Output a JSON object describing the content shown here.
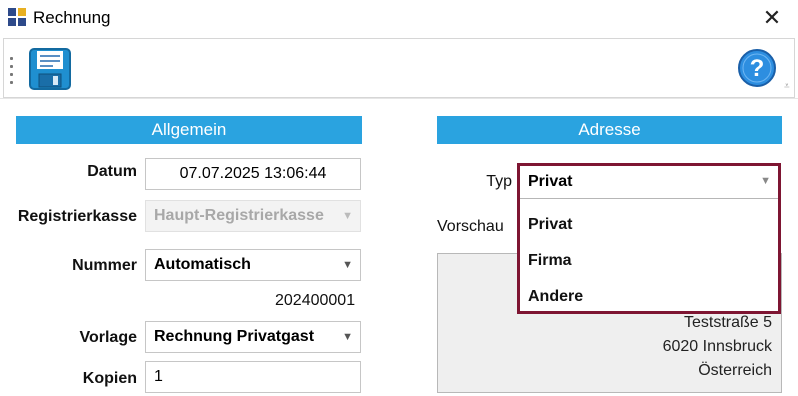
{
  "window": {
    "title": "Rechnung",
    "close_glyph": "✕"
  },
  "toolbar": {
    "save_icon": "floppy-disk-icon",
    "help_icon": "help-question-icon",
    "help_glyph": "?",
    "overflow_glyph": "⩡"
  },
  "colors": {
    "section_header": "#2aa3e0",
    "highlight_border": "#7e1532"
  },
  "general": {
    "header": "Allgemein",
    "datum_label": "Datum",
    "datum_value": "07.07.2025 13:06:44",
    "kasse_label": "Registrierkasse",
    "kasse_value": "Haupt-Registrierkasse",
    "nummer_label": "Nummer",
    "nummer_value": "Automatisch",
    "nummer_preview": "202400001",
    "vorlage_label": "Vorlage",
    "vorlage_value": "Rechnung Privatgast",
    "kopien_label": "Kopien",
    "kopien_value": "1",
    "dropdown_glyph": "▼"
  },
  "address": {
    "header": "Adresse",
    "typ_label": "Typ",
    "typ_value": "Privat",
    "typ_options": [
      "Privat",
      "Firma",
      "Andere"
    ],
    "vorschau_label": "Vorschau",
    "preview_lines": [
      "Teststraße 5",
      "6020 Innsbruck",
      "Österreich"
    ]
  }
}
